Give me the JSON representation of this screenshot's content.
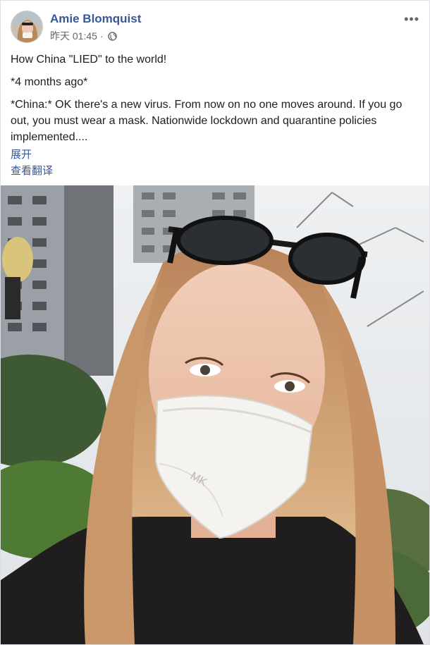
{
  "post": {
    "author": "Amie Blomquist",
    "timestamp": "昨天 01:45",
    "separator": "·",
    "privacy_icon": "globe-icon",
    "more_label": "•••",
    "line1": "How China \"LIED\" to the world!",
    "line2": "*4 months ago*",
    "line3": "*China:* OK there's a new virus. From now on no one moves around. If you go out, you must wear a mask. Nationwide lockdown and quarantine policies implemented....",
    "expand_label": "展开",
    "translate_label": "查看翻译"
  },
  "photo": {
    "mask_text": "MK"
  },
  "colors": {
    "author": "#385898",
    "meta": "#606770",
    "text": "#1c1e21"
  }
}
